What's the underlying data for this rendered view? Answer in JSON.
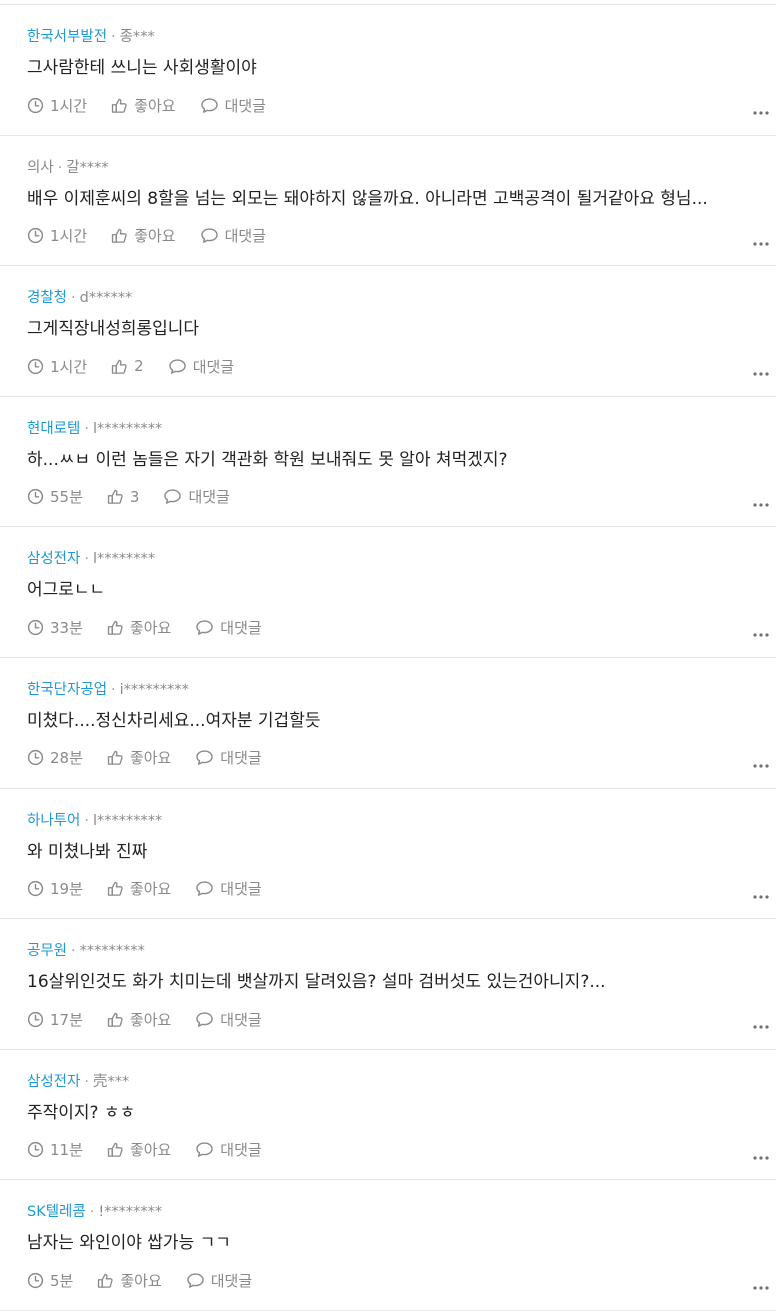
{
  "icons": {
    "time": "clock-icon",
    "like": "thumbs-up-icon",
    "reply": "speech-bubble-icon",
    "more": "more-dots-icon"
  },
  "colors": {
    "company": "#1e9ad6",
    "muted": "#8a8a8a",
    "text": "#222222",
    "divider": "#e8e8e8"
  },
  "comments": [
    {
      "company": "한국서부발전",
      "user": "종***",
      "text": "그사람한테 쓰니는 사회생활이야",
      "time": "1시간",
      "likes": "좋아요",
      "reply": "대댓글",
      "company_color": "blue"
    },
    {
      "company": "의사",
      "user": "갈****",
      "text": "배우 이제훈씨의 8할을 넘는 외모는 돼야하지 않을까요. 아니라면 고백공격이 될거같아요 형님...",
      "time": "1시간",
      "likes": "좋아요",
      "reply": "대댓글",
      "company_color": "gray"
    },
    {
      "company": "경찰청",
      "user": "d******",
      "text": "그게직장내성희롱입니다",
      "time": "1시간",
      "likes": "2",
      "reply": "대댓글",
      "company_color": "blue"
    },
    {
      "company": "현대로템",
      "user": "l*********",
      "text": "하...ㅆㅂ 이런 놈들은 자기 객관화 학원 보내줘도 못 알아 쳐먹겠지?",
      "time": "55분",
      "likes": "3",
      "reply": "대댓글",
      "company_color": "blue"
    },
    {
      "company": "삼성전자",
      "user": "l********",
      "text": "어그로ㄴㄴ",
      "time": "33분",
      "likes": "좋아요",
      "reply": "대댓글",
      "company_color": "blue"
    },
    {
      "company": "한국단자공업",
      "user": "i*********",
      "text": "미쳤다....정신차리세요...여자분 기겁할듯",
      "time": "28분",
      "likes": "좋아요",
      "reply": "대댓글",
      "company_color": "blue"
    },
    {
      "company": "하나투어",
      "user": "l*********",
      "text": "와 미쳤나봐 진짜",
      "time": "19분",
      "likes": "좋아요",
      "reply": "대댓글",
      "company_color": "blue"
    },
    {
      "company": "공무원",
      "user": "*********",
      "text": "16살위인것도 화가 치미는데 뱃살까지 달려있음? 설마 검버섯도 있는건아니지?...",
      "time": "17분",
      "likes": "좋아요",
      "reply": "대댓글",
      "company_color": "blue"
    },
    {
      "company": "삼성전자",
      "user": "壳***",
      "text": "주작이지? ㅎㅎ",
      "time": "11분",
      "likes": "좋아요",
      "reply": "대댓글",
      "company_color": "blue"
    },
    {
      "company": "SK텔레콤",
      "user": "!********",
      "text": "남자는 와인이야 쌉가능 ㄱㄱ",
      "time": "5분",
      "likes": "좋아요",
      "reply": "대댓글",
      "company_color": "blue"
    }
  ]
}
